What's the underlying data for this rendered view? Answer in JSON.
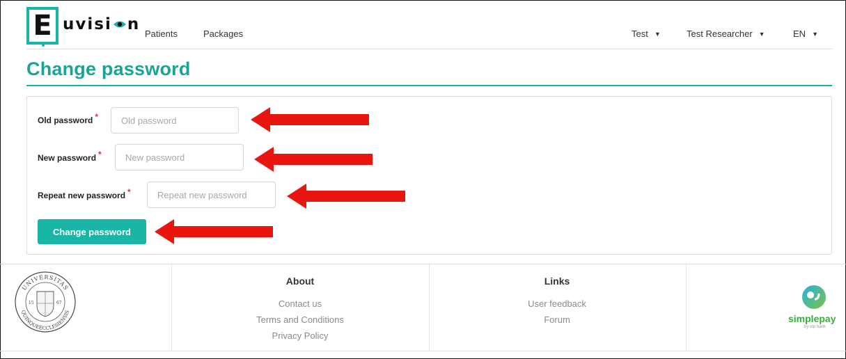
{
  "app": {
    "logo_letter": "E",
    "logo_text_a": "uvisi",
    "logo_text_b": "n"
  },
  "nav": {
    "patients": "Patients",
    "packages": "Packages",
    "test_menu": "Test",
    "user_menu": "Test Researcher",
    "lang_menu": "EN",
    "caret": "▼"
  },
  "page": {
    "title": "Change password"
  },
  "form": {
    "old_label": "Old password",
    "old_placeholder": "Old password",
    "new_label": "New password",
    "new_placeholder": "New password",
    "repeat_label": "Repeat new password",
    "repeat_placeholder": "Repeat new password",
    "required_mark": "*",
    "submit_label": "Change password"
  },
  "footer": {
    "about_heading": "About",
    "about_links": [
      "Contact us",
      "Terms and Conditions",
      "Privacy Policy"
    ],
    "links_heading": "Links",
    "links_links": [
      "User feedback",
      "Forum"
    ],
    "seal_text_top": "UNIVERSITAS",
    "seal_text_bottom": "QUINQUEECCLESIENSIS",
    "seal_years_left": "15",
    "seal_years_right": "67",
    "simplepay_label": "simplepay",
    "simplepay_sub": "by otp bank"
  },
  "colors": {
    "accent": "#19b5a6",
    "arrow": "#e8160f",
    "required": "#e0302b"
  }
}
